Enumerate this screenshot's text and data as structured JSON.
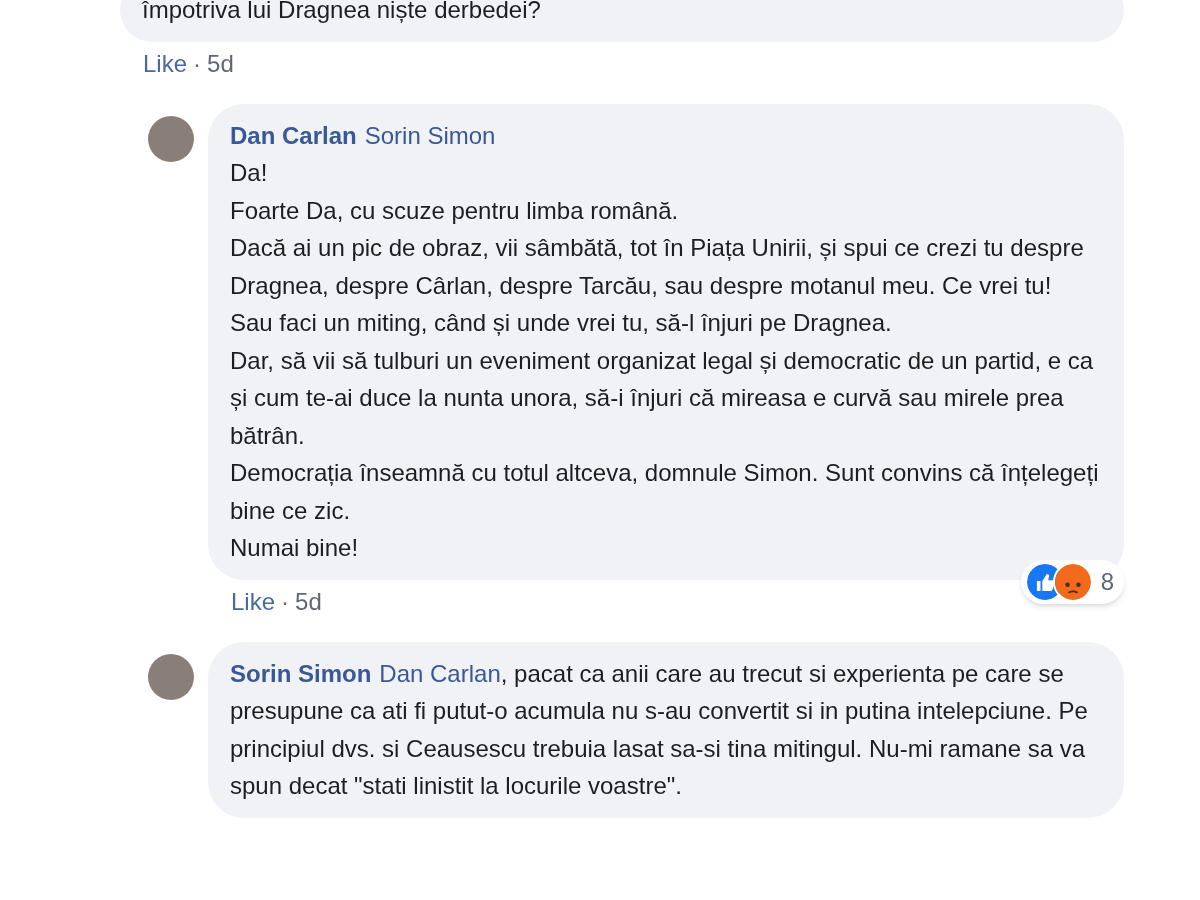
{
  "comments": [
    {
      "paragraphs": [
        "împotriva lui Dragnea niște derbedei?"
      ],
      "actions": {
        "like": "Like",
        "separator": "·",
        "time": "5d"
      }
    },
    {
      "avatar": true,
      "author": "Dan Carlan",
      "mention": "Sorin Simon",
      "paragraphs": [
        "Da!",
        "Foarte Da, cu scuze pentru limba română.",
        "Dacă ai un pic de obraz, vii sâmbătă, tot în Piața Unirii, și spui ce crezi tu despre Dragnea, despre Cârlan, despre Tarcău, sau despre motanul meu. Ce vrei tu!",
        "Sau faci un miting, când și unde vrei tu, să-l înjuri pe Dragnea.",
        "Dar, să vii să tulburi un eveniment organizat legal și democratic de un partid, e ca și cum te-ai duce la nunta unora, să-i înjuri că mireasa e curvă sau mirele prea bătrân.",
        "Democrația înseamnă cu totul altceva, domnule Simon. Sunt convins că înțelegeți bine ce zic.",
        "Numai bine!"
      ],
      "actions": {
        "like": "Like",
        "separator": "·",
        "time": "5d"
      },
      "reactions": [
        {
          "kind": "like"
        },
        {
          "kind": "angry"
        }
      ],
      "reaction_count": "8"
    },
    {
      "avatar": true,
      "author": "Sorin Simon",
      "mention": "Dan Carlan",
      "text": ", pacat ca anii care au trecut si experienta pe care se presupune ca ati fi putut-o acumula nu s-au convertit si in putina intelepciune. Pe principiul dvs. si Ceausescu trebuia lasat sa-si tina mitingul. Nu-mi ramane sa va spun decat \"stati linistit la locurile voastre\"."
    }
  ]
}
